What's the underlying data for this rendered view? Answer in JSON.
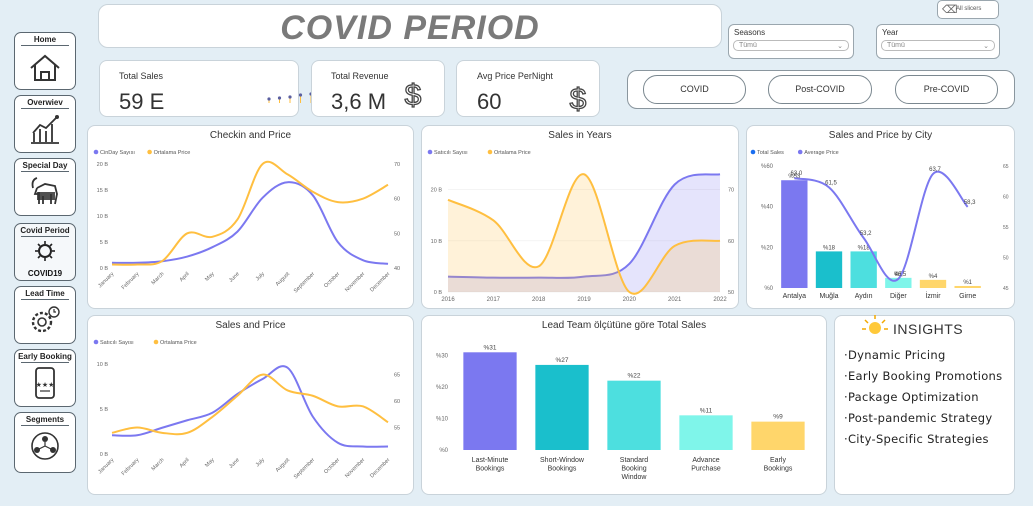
{
  "title": "COVID PERIOD",
  "clear_label": "All slicers",
  "nav": [
    {
      "label": "Home",
      "icon": "home-icon"
    },
    {
      "label": "Overwiev",
      "icon": "trend-chart-icon"
    },
    {
      "label": "Special Day",
      "icon": "goat-icon"
    },
    {
      "label": "Covid Period",
      "icon": "covid-icon",
      "sub": "COVID19"
    },
    {
      "label": "Lead Time",
      "icon": "gear-clock-icon"
    },
    {
      "label": "Early Booking",
      "icon": "phone-rating-icon"
    },
    {
      "label": "Segments",
      "icon": "network-icon"
    }
  ],
  "kpis": [
    {
      "label": "Total Sales",
      "value": "59 E"
    },
    {
      "label": "Total Revenue",
      "value": "3,6 M"
    },
    {
      "label": "Avg Price PerNight",
      "value": "60"
    }
  ],
  "slicers": [
    {
      "label": "Seasons",
      "value": "Tümü"
    },
    {
      "label": "Year",
      "value": "Tümü"
    }
  ],
  "period_buttons": [
    "COVID",
    "Post-COVID",
    "Pre-COVID"
  ],
  "insights": {
    "title": "INSIGHTS",
    "items": [
      "Dynamic Pricing",
      "Early Booking Promotions",
      "Package Optimization",
      "Post-pandemic Strategy",
      "City-Specific Strategies"
    ]
  },
  "colors": {
    "purple": "#7b78f0",
    "orange": "#ffbf40",
    "teal": "#1abfcc",
    "blue": "#1a6ef0"
  },
  "chart_data": [
    {
      "id": "checkin",
      "type": "line",
      "title": "Checkin and Price",
      "categories": [
        "January",
        "February",
        "March",
        "April",
        "May",
        "June",
        "July",
        "August",
        "September",
        "October",
        "November",
        "December"
      ],
      "series": [
        {
          "name": "CinDay Sayısı",
          "axis": "left",
          "values": [
            1.0,
            1.0,
            1.3,
            2.2,
            4.0,
            7.0,
            13.5,
            16.5,
            14.0,
            5.0,
            1.5,
            0.8
          ]
        },
        {
          "name": "Ortalama Price",
          "axis": "right",
          "values": [
            41,
            41,
            42,
            50,
            49,
            54,
            70,
            67,
            62,
            59,
            60,
            64
          ]
        }
      ],
      "y_left": {
        "min": 0,
        "max": 20,
        "ticks": [
          "0 B",
          "5 B",
          "10 B",
          "15 B",
          "20 B"
        ]
      },
      "y_right": {
        "min": 40,
        "max": 70,
        "ticks": [
          "40",
          "50",
          "60",
          "70"
        ]
      }
    },
    {
      "id": "years",
      "type": "area",
      "title": "Sales in Years",
      "categories": [
        "2016",
        "2017",
        "2018",
        "2019",
        "2020",
        "2021",
        "2022"
      ],
      "series": [
        {
          "name": "Satıcılı Sayısı",
          "axis": "left",
          "values": [
            3,
            2.8,
            2.8,
            3,
            5.5,
            21,
            23
          ]
        },
        {
          "name": "Ortalama Price",
          "axis": "right",
          "values": [
            68,
            64,
            55,
            73,
            50,
            59,
            60
          ]
        }
      ],
      "y_left": {
        "min": 0,
        "max": 25,
        "ticks": [
          "0 B",
          "10 B",
          "20 B"
        ]
      },
      "y_right": {
        "min": 50,
        "max": 75,
        "ticks": [
          "50",
          "60",
          "70"
        ]
      }
    },
    {
      "id": "city",
      "type": "bar",
      "title": "Sales and Price by City",
      "categories": [
        "Antalya",
        "Muğla",
        "Aydın",
        "Diğer",
        "İzmir",
        "Girne"
      ],
      "series": [
        {
          "name": "Total Sales",
          "axis": "left",
          "values": [
            53,
            18,
            18,
            5,
            4,
            1
          ],
          "labels": [
            "%53",
            "%18",
            "%18",
            "%5",
            "%4",
            "%1"
          ]
        },
        {
          "name": "Average Price",
          "axis": "right",
          "values": [
            63.0,
            61.5,
            53.2,
            46.5,
            63.7,
            58.3
          ],
          "labels": [
            "63,0",
            "61,5",
            "53,2",
            "46,5",
            "63,7",
            "58,3"
          ]
        }
      ],
      "y_left": {
        "min": 0,
        "max": 60,
        "ticks": [
          "%0",
          "%20",
          "%40",
          "%60"
        ]
      },
      "y_right": {
        "min": 45,
        "max": 65,
        "ticks": [
          "45",
          "50",
          "55",
          "60",
          "65"
        ]
      }
    },
    {
      "id": "salesprice",
      "type": "line",
      "title": "Sales and Price",
      "categories": [
        "January",
        "February",
        "March",
        "April",
        "May",
        "June",
        "July",
        "August",
        "September",
        "October",
        "November",
        "December"
      ],
      "series": [
        {
          "name": "Satıcılı Sayısı",
          "axis": "left",
          "values": [
            2.5,
            2.5,
            3.5,
            4.5,
            5.5,
            8,
            10,
            11.5,
            5,
            1.5,
            1.0,
            1.0
          ]
        },
        {
          "name": "Ortalama Price",
          "axis": "right",
          "values": [
            54,
            55,
            54,
            54,
            57,
            61,
            65,
            62,
            61,
            59,
            59,
            56
          ]
        }
      ],
      "y_left": {
        "min": 0,
        "max": 12,
        "ticks": [
          "0 B",
          "5 B",
          "10 B"
        ]
      },
      "y_right": {
        "min": 50,
        "max": 67,
        "ticks": [
          "55",
          "60",
          "65"
        ]
      }
    },
    {
      "id": "leadteam",
      "type": "bar",
      "title": "Lead Team ölçütüne göre Total Sales",
      "categories": [
        "Last-Minute Bookings",
        "Short-Window Bookings",
        "Standard Booking Window",
        "Advance Purchase",
        "Early Bookings"
      ],
      "values": [
        31,
        27,
        22,
        11,
        9
      ],
      "labels": [
        "%31",
        "%27",
        "%22",
        "%11",
        "%9"
      ],
      "colors": [
        "#7b78f0",
        "#1abfcc",
        "#4ddfdf",
        "#7ff5ea",
        "#ffd66b"
      ],
      "y": {
        "min": 0,
        "max": 33,
        "ticks": [
          "%0",
          "%10",
          "%20",
          "%30"
        ]
      }
    }
  ]
}
